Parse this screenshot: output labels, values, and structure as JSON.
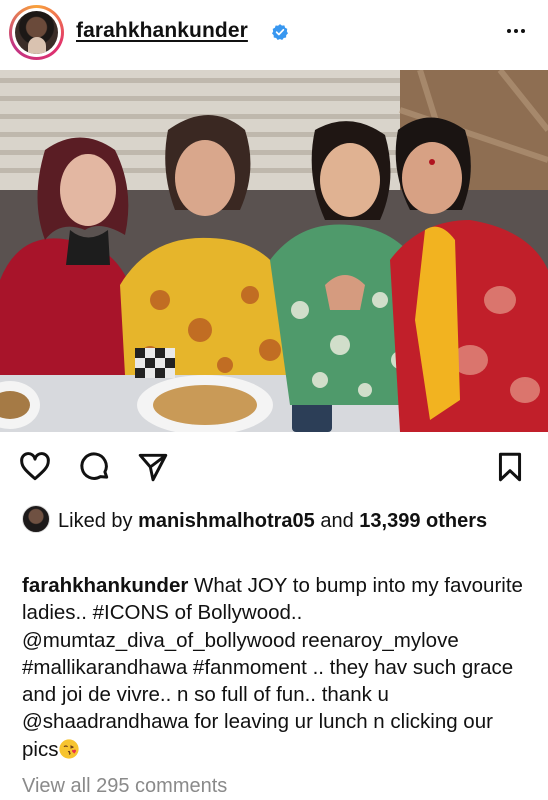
{
  "post": {
    "username": "farahkhankunder",
    "verified": true,
    "liked_by_prefix": "Liked by",
    "liked_by_user": "manishmalhotra05",
    "liked_by_and": "and",
    "liked_by_count": "13,399",
    "liked_by_others": "others",
    "caption_user": "farahkhankunder",
    "caption_text": "What JOY to bump into my favourite ladies.. #ICONS of Bollywood.. @mumtaz_diva_of_bollywood reenaroy_mylove #mallikarandhawa #fanmoment .. they hav such grace and joi de vivre.. n so full of fun.. thank u @shaadrandhawa for leaving ur lunch n clicking our pics",
    "view_comments": "View all 295 comments"
  },
  "icons": {
    "more": "more-options-icon",
    "like": "heart-icon",
    "comment": "comment-icon",
    "share": "send-icon",
    "save": "bookmark-icon",
    "emoji": "kissing-face-emoji"
  },
  "colors": {
    "verified": "#3897f0",
    "muted_text": "#8a8a8a"
  }
}
